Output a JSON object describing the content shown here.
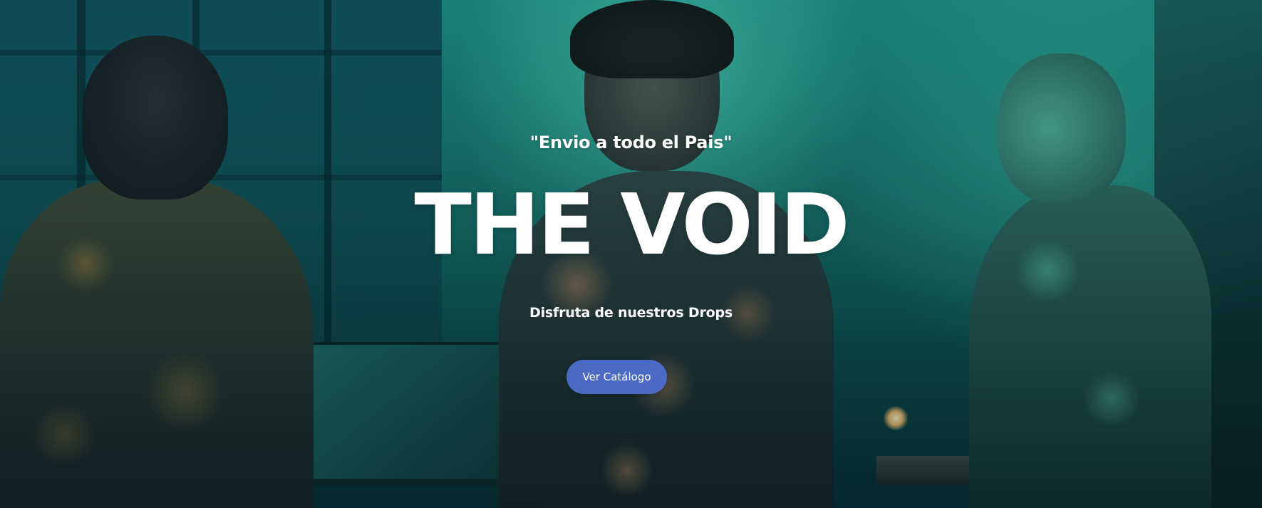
{
  "hero": {
    "tagline": "\"Envio a todo el Pais\"",
    "title": "THE VOID",
    "subtitle": "Disfruta de nuestros Drops",
    "cta_label": "Ver Catálogo"
  },
  "colors": {
    "cta_background": "#4a6ac4",
    "text": "#ffffff",
    "scene_tint": "#1d8a80"
  }
}
